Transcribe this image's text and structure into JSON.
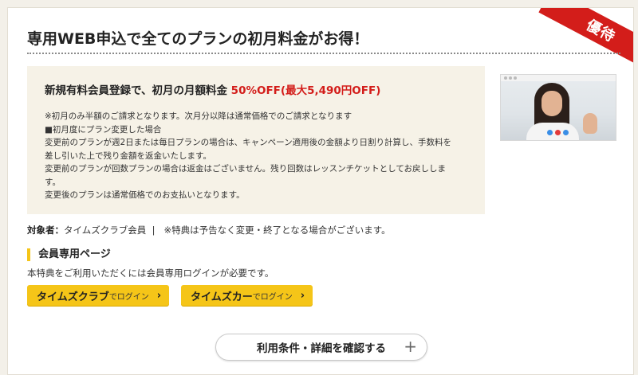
{
  "badge": {
    "label": "優待"
  },
  "title": "専用WEB申込で全てのプランの初月料金がお得！",
  "promo": {
    "headline_prefix": "新規有料会員登録で、初月の月額料金 ",
    "headline_highlight": "50%OFF(最大5,490円OFF)",
    "highlight_color": "#d31d1a",
    "notes": [
      "※初月のみ半額のご請求となります。次月分以降は通常価格でのご請求となります",
      "■初月度にプラン変更した場合",
      "変更前のプランが週2日または毎日プランの場合は、キャンペーン適用後の金額より日割り計算し、手数料を",
      "差し引いた上で残り金額を返金いたします。",
      "変更前のプランが回数プランの場合は返金はございません。残り回数はレッスンチケットとしてお戻ししま",
      "す。",
      "変更後のプランは通常価格でのお支払いとなります。"
    ]
  },
  "target": {
    "label": "対象者：",
    "value": "タイムズクラブ会員",
    "separator": "|",
    "note": "※特典は予告なく変更・終了となる場合がございます。"
  },
  "members": {
    "heading": "会員専用ページ",
    "description": "本特典をご利用いただくには会員専用ログインが必要です。",
    "accent_color": "#f5c518",
    "buttons": [
      {
        "name": "タイムズクラブ",
        "suffix": "でログイン",
        "chevron": "›"
      },
      {
        "name": "タイムズカー",
        "suffix": "でログイン",
        "chevron": "›"
      }
    ]
  },
  "details_button": {
    "label": "利用条件・詳細を確認する",
    "icon": "plus-icon",
    "symbol": "+"
  },
  "video_thumbnail": {
    "icon": "video-call-thumbnail"
  }
}
